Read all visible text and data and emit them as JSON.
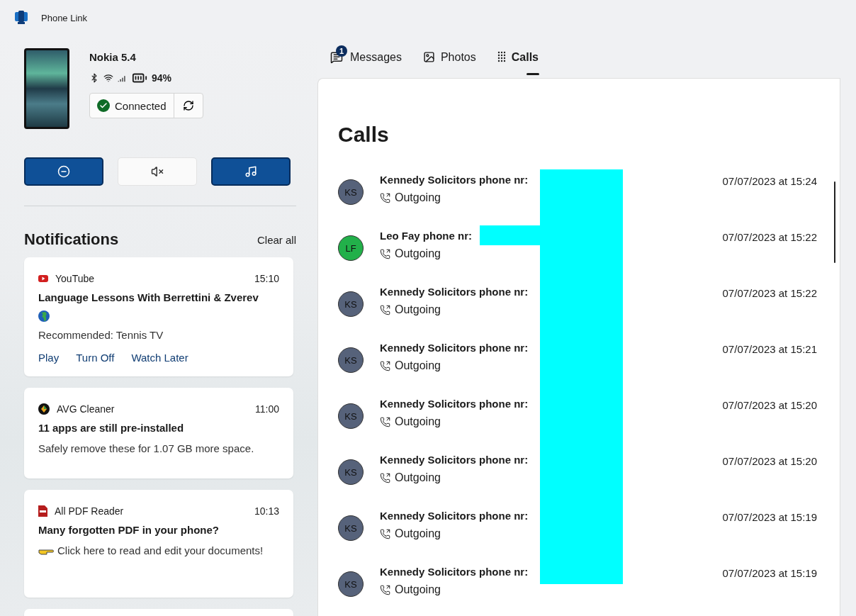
{
  "app": {
    "title": "Phone Link"
  },
  "device": {
    "name": "Nokia 5.4",
    "battery": "94%",
    "status": "Connected",
    "connected": true
  },
  "quick_actions": [
    {
      "kind": "dnd",
      "on": true
    },
    {
      "kind": "mute",
      "on": false
    },
    {
      "kind": "media",
      "on": true
    }
  ],
  "notifications": {
    "title": "Notifications",
    "clear_label": "Clear all",
    "items": [
      {
        "app": "YouTube",
        "kind": "youtube",
        "time": "15:10",
        "title": "Language Lessons With Berrettini & Zverev",
        "body": "Recommended: Tennis TV",
        "actions": [
          "Play",
          "Turn Off",
          "Watch Later"
        ]
      },
      {
        "app": "AVG Cleaner",
        "kind": "avg",
        "time": "11:00",
        "title": "11 apps are still pre-installed",
        "body": "Safely remove these for 1.07 GB more space."
      },
      {
        "app": "All PDF Reader",
        "kind": "pdf",
        "time": "10:13",
        "title": "Many forgotten PDF in your phone?",
        "body": "Click here to read and edit your documents!"
      }
    ]
  },
  "tabs": [
    {
      "label": "Messages",
      "kind": "messages",
      "badge": "1",
      "selected": false
    },
    {
      "label": "Photos",
      "kind": "photos",
      "selected": false
    },
    {
      "label": "Calls",
      "kind": "calls",
      "selected": true
    }
  ],
  "calls": {
    "title": "Calls",
    "rows": [
      {
        "initials": "KS",
        "color": "#56627a",
        "name": "Kennedy Solicitors phone nr:",
        "direction": "Outgoing",
        "time": "07/07/2023 at 15:24"
      },
      {
        "initials": "LF",
        "color": "#22b04a",
        "name": "Leo Fay phone nr:",
        "direction": "Outgoing",
        "time": "07/07/2023 at 15:22"
      },
      {
        "initials": "KS",
        "color": "#56627a",
        "name": "Kennedy Solicitors phone nr:",
        "direction": "Outgoing",
        "time": "07/07/2023 at 15:22"
      },
      {
        "initials": "KS",
        "color": "#56627a",
        "name": "Kennedy Solicitors phone nr:",
        "direction": "Outgoing",
        "time": "07/07/2023 at 15:21"
      },
      {
        "initials": "KS",
        "color": "#56627a",
        "name": "Kennedy Solicitors phone nr:",
        "direction": "Outgoing",
        "time": "07/07/2023 at 15:20"
      },
      {
        "initials": "KS",
        "color": "#56627a",
        "name": "Kennedy Solicitors phone nr:",
        "direction": "Outgoing",
        "time": "07/07/2023 at 15:20"
      },
      {
        "initials": "KS",
        "color": "#56627a",
        "name": "Kennedy Solicitors phone nr:",
        "direction": "Outgoing",
        "time": "07/07/2023 at 15:19"
      },
      {
        "initials": "KS",
        "color": "#56627a",
        "name": "Kennedy Solicitors phone nr:",
        "direction": "Outgoing",
        "time": "07/07/2023 at 15:19"
      }
    ]
  }
}
